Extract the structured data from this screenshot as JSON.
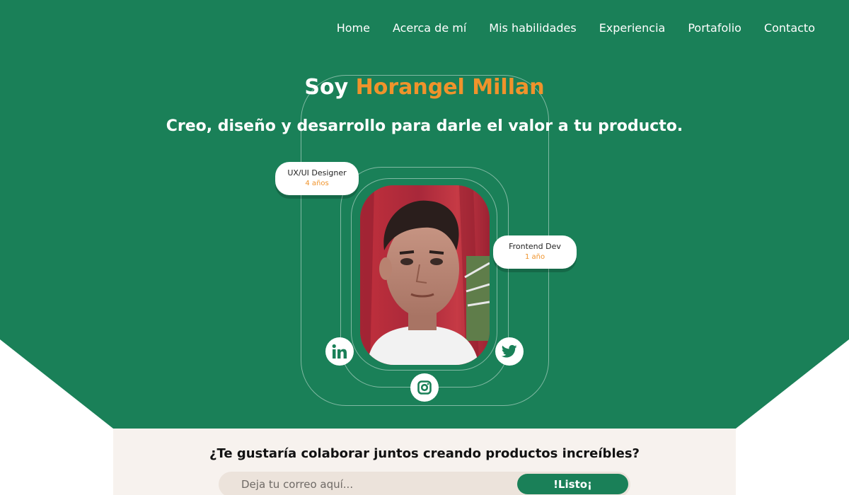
{
  "colors": {
    "primary": "#1a8058",
    "accent": "#f0932b",
    "cta_bg": "#f7f2ee",
    "input_bg": "#ece3db"
  },
  "nav": {
    "items": [
      {
        "label": "Home"
      },
      {
        "label": "Acerca de mí"
      },
      {
        "label": "Mis habilidades"
      },
      {
        "label": "Experiencia"
      },
      {
        "label": "Portafolio"
      },
      {
        "label": "Contacto"
      }
    ]
  },
  "hero": {
    "greeting": "Soy",
    "name": "Horangel Millan",
    "tagline": "Creo, diseño y desarrollo para darle el valor a tu producto.",
    "badges": [
      {
        "role": "UX/UI Designer",
        "years": "4 años"
      },
      {
        "role": "Frontend Dev",
        "years": "1 año"
      }
    ],
    "social": [
      "linkedin-icon",
      "twitter-icon",
      "instagram-icon"
    ]
  },
  "cta": {
    "question": "¿Te gustaría colaborar juntos creando productos increíbles?",
    "email_placeholder": "Deja tu correo aquí...",
    "button_label": "!Listo¡"
  }
}
